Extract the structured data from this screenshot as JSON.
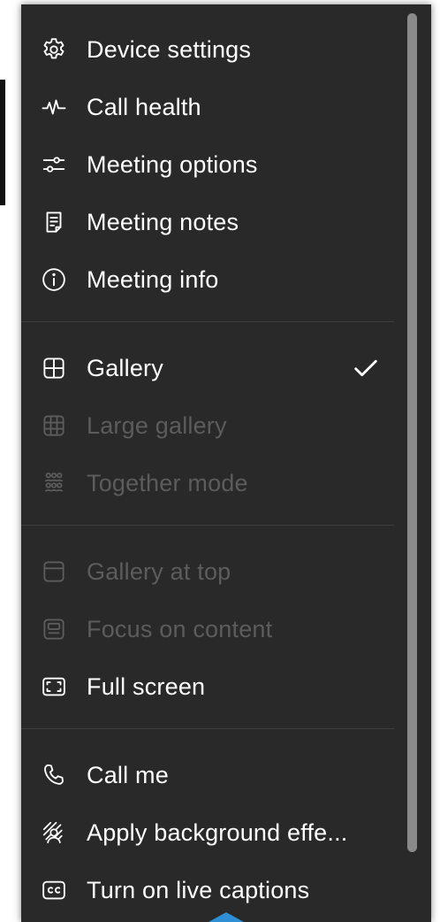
{
  "menu": {
    "group1": [
      {
        "label": "Device settings",
        "icon": "gear-icon"
      },
      {
        "label": "Call health",
        "icon": "pulse-icon"
      },
      {
        "label": "Meeting options",
        "icon": "sliders-icon"
      },
      {
        "label": "Meeting notes",
        "icon": "notes-icon"
      },
      {
        "label": "Meeting info",
        "icon": "info-icon"
      }
    ],
    "group2": [
      {
        "label": "Gallery",
        "icon": "gallery-icon",
        "checked": true
      },
      {
        "label": "Large gallery",
        "icon": "large-gallery-icon",
        "disabled": true
      },
      {
        "label": "Together mode",
        "icon": "together-mode-icon",
        "disabled": true
      }
    ],
    "group3": [
      {
        "label": "Gallery at top",
        "icon": "gallery-top-icon",
        "disabled": true
      },
      {
        "label": "Focus on content",
        "icon": "focus-content-icon",
        "disabled": true
      },
      {
        "label": "Full screen",
        "icon": "full-screen-icon"
      }
    ],
    "group4": [
      {
        "label": "Call me",
        "icon": "phone-icon"
      },
      {
        "label": "Apply background effe...",
        "icon": "background-effects-icon"
      },
      {
        "label": "Turn on live captions",
        "icon": "captions-icon"
      }
    ]
  },
  "colors": {
    "menu_bg": "#292929",
    "text": "#ffffff",
    "disabled_text": "#5c5c5c",
    "pointer": "#2f8fd4"
  }
}
